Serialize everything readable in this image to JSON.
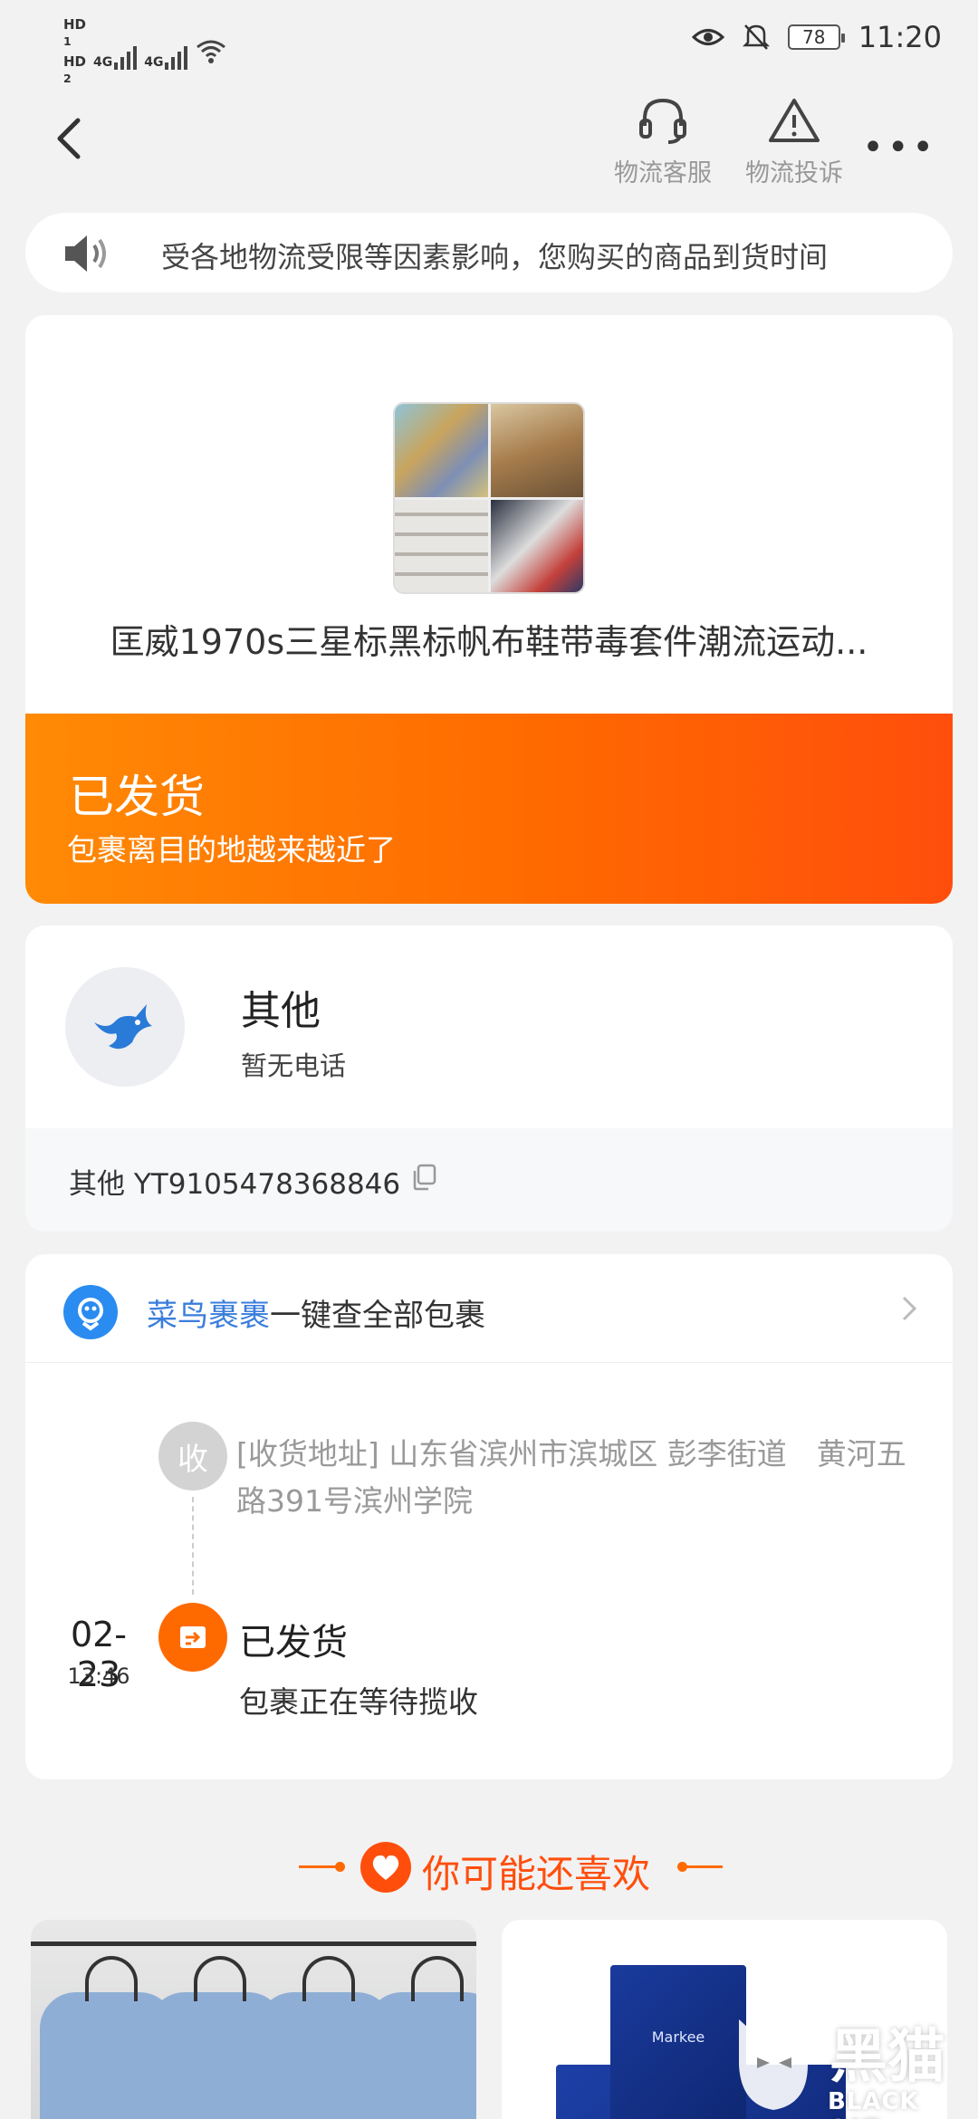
{
  "status_bar": {
    "hd1": "HD",
    "hd1_sub": "1",
    "hd2": "HD",
    "hd2_sub": "2",
    "sig1": "4G",
    "sig2": "4G",
    "battery": "78",
    "time": "11:20"
  },
  "header": {
    "customer_service_label": "物流客服",
    "complaint_label": "物流投诉",
    "more_label": "•••"
  },
  "notice": {
    "text": "受各地物流受限等因素影响，您购买的商品到货时间"
  },
  "product": {
    "title": "匡威1970s三星标黑标帆布鞋带毒套件潮流运动..."
  },
  "shipping_status": {
    "title": "已发货",
    "subtitle": "包裹离目的地越来越近了"
  },
  "courier": {
    "name": "其他",
    "phone": "暂无电话",
    "tracking": "其他 YT9105478368846"
  },
  "cainiao": {
    "brand": "菜鸟裹裹",
    "text": "一键查全部包裹"
  },
  "timeline": {
    "recv_badge": "收",
    "address": "[收货地址] 山东省滨州市滨城区 彭李街道　黄河五路391号滨州学院",
    "event_date": "02-23",
    "event_time": "13:46",
    "event_title": "已发货",
    "event_desc": "包裹正在等待揽收"
  },
  "recommend": {
    "title": "你可能还喜欢",
    "box_label": "Markee"
  },
  "watermark": {
    "cn": "黑猫",
    "en": "BLACK CAT"
  },
  "colors": {
    "accent": "#ff6a00",
    "brand_blue": "#3a7ddc"
  }
}
